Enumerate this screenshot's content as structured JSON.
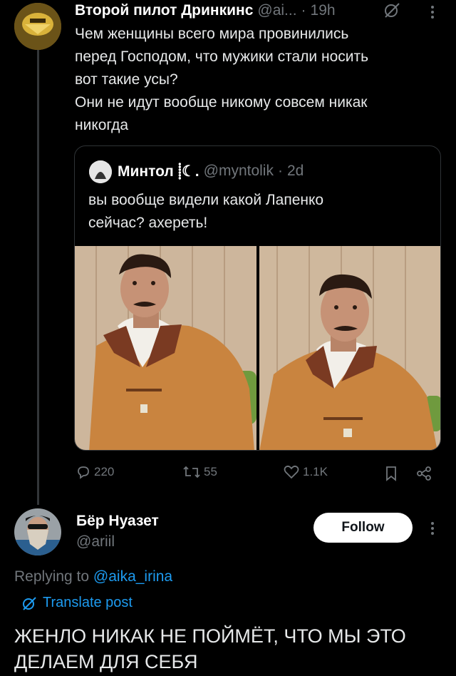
{
  "top_tweet": {
    "author_name": "Второй пилот Дринкинс",
    "handle": "@ai...",
    "separator": "·",
    "time": "19h",
    "text_lines": [
      "Чем женщины всего мира провинились",
      "перед Господом, что мужики стали носить",
      "вот такие усы?",
      "Они не идут вообще никому совсем никак",
      "никогда"
    ]
  },
  "quoted_tweet": {
    "author_name": "Минтол ⸽☾.",
    "handle": "@myntolik",
    "separator": "·",
    "time": "2d",
    "text_lines": [
      "вы вообще видели какой Лапенко",
      "сейчас? ахереть!"
    ]
  },
  "actions": {
    "replies": "220",
    "reposts": "55",
    "likes": "1.1K"
  },
  "reply_tweet": {
    "author_name": "Бёр Нуазет",
    "handle": "@ariil",
    "follow_label": "Follow",
    "replying_prefix": "Replying to",
    "replying_handle": "@aika_irina",
    "translate_label": "Translate post",
    "text_lines": [
      "ЖЕНЛО НИКАК НЕ ПОЙМЁТ, ЧТО МЫ ЭТО",
      "ДЕЛАЕМ ДЛЯ СЕБЯ"
    ]
  },
  "colors": {
    "background": "#000000",
    "text": "#e7e9ea",
    "muted": "#71767b",
    "link": "#1d9bf0",
    "jacket": "#c9843f",
    "wall": "#cdb69c"
  },
  "icons": [
    "grok-icon",
    "more-icon",
    "reply-icon",
    "repost-icon",
    "like-icon",
    "bookmark-icon",
    "share-icon",
    "translate-icon"
  ]
}
